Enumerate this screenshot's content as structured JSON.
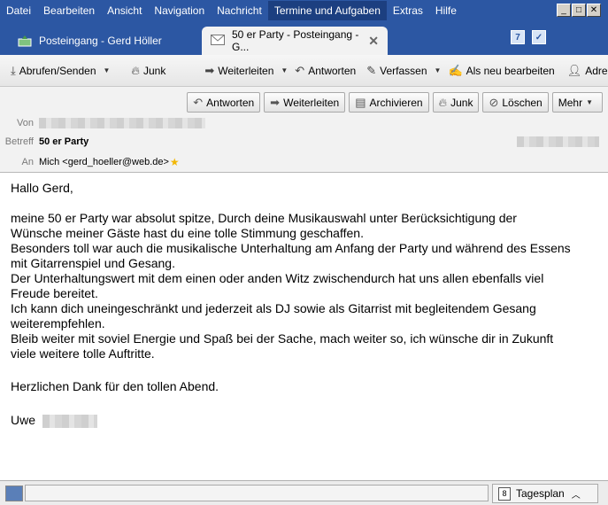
{
  "menubar": {
    "items": [
      {
        "label": "Datei"
      },
      {
        "label": "Bearbeiten"
      },
      {
        "label": "Ansicht"
      },
      {
        "label": "Navigation"
      },
      {
        "label": "Nachricht"
      },
      {
        "label": "Termine und Aufgaben"
      },
      {
        "label": "Extras"
      },
      {
        "label": "Hilfe"
      }
    ]
  },
  "tabs": [
    {
      "label": "Posteingang - Gerd Höller",
      "icon": "inbox-icon"
    },
    {
      "label": "50 er Party - Posteingang - G...",
      "icon": "envelope-icon"
    }
  ],
  "toolbar": {
    "fetch": "Abrufen/Senden",
    "junk": "Junk",
    "forward": "Weiterleiten",
    "reply": "Antworten",
    "compose": "Verfassen",
    "edit_as_new": "Als neu bearbeiten",
    "address": "Adre"
  },
  "header_buttons": {
    "reply": "Antworten",
    "forward": "Weiterleiten",
    "archive": "Archivieren",
    "junk": "Junk",
    "delete": "Löschen",
    "more": "Mehr"
  },
  "header": {
    "from_label": "Von",
    "subject_label": "Betreff",
    "subject": "50 er Party",
    "to_label": "An",
    "to": "Mich <gerd_hoeller@web.de>"
  },
  "body": {
    "greeting": "Hallo Gerd,",
    "lines": [
      "meine 50 er Party war absolut spitze, Durch deine Musikauswahl unter Berücksichtigung der",
      "Wünsche meiner Gäste hast du eine tolle Stimmung geschaffen.",
      "Besonders toll war auch die musikalische Unterhaltung am Anfang der Party und während des Essens",
      "mit Gitarrenspiel und Gesang.",
      "Der Unterhaltungswert mit dem einen oder anden Witz zwischendurch hat uns allen ebenfalls viel",
      "Freude bereitet.",
      "Ich kann dich uneingeschränkt und jederzeit als DJ sowie als Gitarrist mit begleitendem Gesang",
      "weiterempfehlen.",
      "Bleib weiter mit soviel Energie und Spaß bei der Sache, mach weiter so, ich wünsche dir in Zukunft",
      "viele weitere tolle Auftritte."
    ],
    "thanks": "Herzlichen Dank für den tollen Abend.",
    "signature": "Uwe"
  },
  "statusbar": {
    "calendar_label": "Tagesplan",
    "calendar_day": "8"
  }
}
